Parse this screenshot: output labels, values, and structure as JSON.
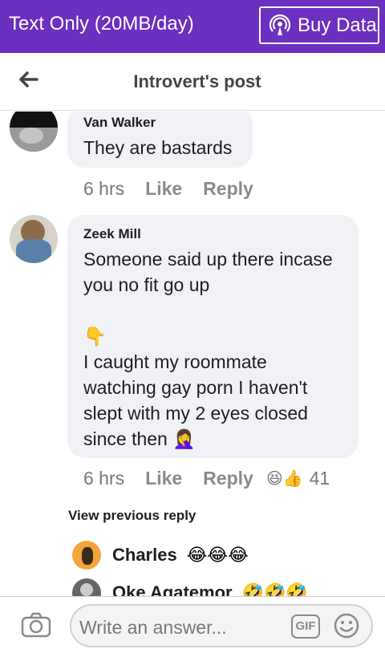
{
  "topbar": {
    "mode": "Text Only (20MB/day)",
    "buy_label": "Buy Data"
  },
  "header": {
    "title": "Introvert's post"
  },
  "comments": [
    {
      "name": "Van Walker",
      "text": "They are bastards",
      "time": "6 hrs",
      "like": "Like",
      "reply": "Reply"
    },
    {
      "name": "Zeek Mill",
      "text": "Someone said up there incase\nyou no fit go up\n\n👇\nI caught my roommate\nwatching gay porn I haven't\nslept with my 2 eyes closed\nsince then 🤦‍♀️",
      "time": "6 hrs",
      "like": "Like",
      "reply": "Reply",
      "reaction_count": "41",
      "reaction_emoji": "😆👍"
    }
  ],
  "view_previous": "View previous reply",
  "replies": [
    {
      "name": "Charles",
      "emoji": "😂😂😂"
    },
    {
      "name": "Oke Agatemor",
      "emoji": "🤣🤣🤣"
    }
  ],
  "composer": {
    "placeholder": "Write an answer...",
    "gif": "GIF"
  },
  "colors": {
    "topbar": "#6c2fbf",
    "bubble": "#f0f2f5",
    "meta": "#777777"
  },
  "icons": [
    "broadcast-icon",
    "back-arrow-icon",
    "camera-icon",
    "smiley-icon"
  ]
}
